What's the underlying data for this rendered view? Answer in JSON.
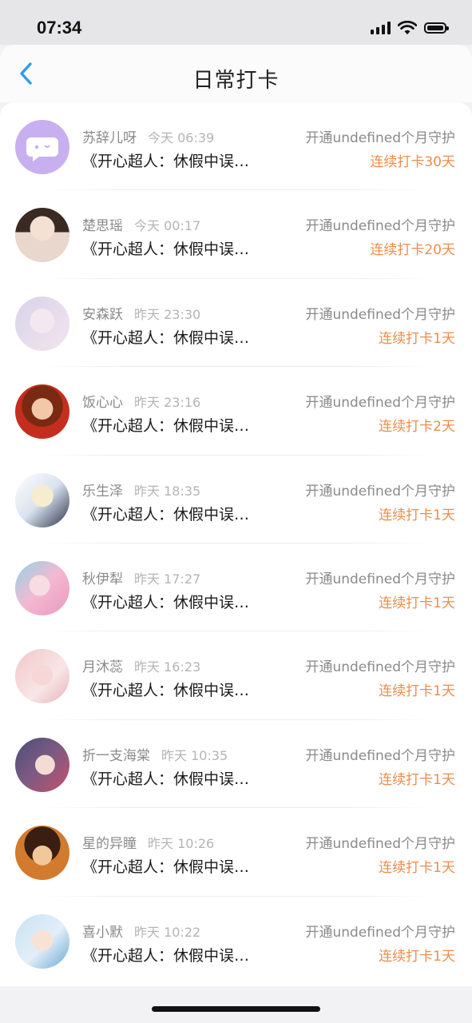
{
  "status_bar": {
    "time": "07:34"
  },
  "header": {
    "title": "日常打卡"
  },
  "colors": {
    "accent": "#f08c4a",
    "back": "#2d9cf0"
  },
  "items": [
    {
      "name": "苏辞儿呀",
      "time": "今天 06:39",
      "excerpt": "《开心超人：休假中误…",
      "guard": "开通undefined个月守护",
      "streak": "连续打卡30天"
    },
    {
      "name": "楚思瑶",
      "time": "今天 00:17",
      "excerpt": "《开心超人：休假中误…",
      "guard": "开通undefined个月守护",
      "streak": "连续打卡20天"
    },
    {
      "name": "安森跃",
      "time": "昨天 23:30",
      "excerpt": "《开心超人：休假中误…",
      "guard": "开通undefined个月守护",
      "streak": "连续打卡1天"
    },
    {
      "name": "饭心心",
      "time": "昨天 23:16",
      "excerpt": "《开心超人：休假中误…",
      "guard": "开通undefined个月守护",
      "streak": "连续打卡2天"
    },
    {
      "name": "乐生泽",
      "time": "昨天 18:35",
      "excerpt": "《开心超人：休假中误…",
      "guard": "开通undefined个月守护",
      "streak": "连续打卡1天"
    },
    {
      "name": "秋伊犁",
      "time": "昨天 17:27",
      "excerpt": "《开心超人：休假中误…",
      "guard": "开通undefined个月守护",
      "streak": "连续打卡1天"
    },
    {
      "name": "月沐蕊",
      "time": "昨天 16:23",
      "excerpt": "《开心超人：休假中误…",
      "guard": "开通undefined个月守护",
      "streak": "连续打卡1天"
    },
    {
      "name": "折一支海棠",
      "time": "昨天 10:35",
      "excerpt": "《开心超人：休假中误…",
      "guard": "开通undefined个月守护",
      "streak": "连续打卡1天"
    },
    {
      "name": "星的异瞳",
      "time": "昨天 10:26",
      "excerpt": "《开心超人：休假中误…",
      "guard": "开通undefined个月守护",
      "streak": "连续打卡1天"
    },
    {
      "name": "喜小默",
      "time": "昨天 10:22",
      "excerpt": "《开心超人：休假中误…",
      "guard": "开通undefined个月守护",
      "streak": "连续打卡1天"
    }
  ]
}
